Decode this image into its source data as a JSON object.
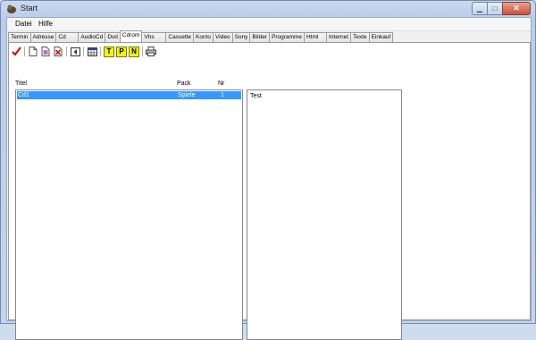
{
  "window": {
    "title": "Start"
  },
  "menu": [
    "Datei",
    "Hilfe"
  ],
  "tabs": [
    "Termin",
    "Adresse",
    "Cd",
    "AudioCd",
    "Dvd",
    "Cdrom",
    "Vhs",
    "Cassette",
    "Konto",
    "Video",
    "Sony",
    "Bilder",
    "Programme",
    "Html",
    "Internet",
    "Texte",
    "Einkauf"
  ],
  "active_tab": "Cdrom",
  "toolbar": {
    "icons": [
      "checkmark-icon",
      "new-document-icon",
      "edit-document-icon",
      "delete-document-icon",
      "back-icon",
      "table-icon",
      "letter-t-icon",
      "letter-p-icon",
      "letter-n-icon",
      "print-icon"
    ],
    "letters": [
      "T",
      "P",
      "N"
    ]
  },
  "list": {
    "columns": [
      "Titel",
      "Pack",
      "Nr"
    ],
    "rows": [
      {
        "titel": "Cd1",
        "pack": "Spiele",
        "nr": "1"
      }
    ]
  },
  "textbox": {
    "value": "Test"
  },
  "colors": {
    "selection": "#3399ff",
    "close_button": "#c8533b",
    "letter_button": "#f2f20a"
  }
}
